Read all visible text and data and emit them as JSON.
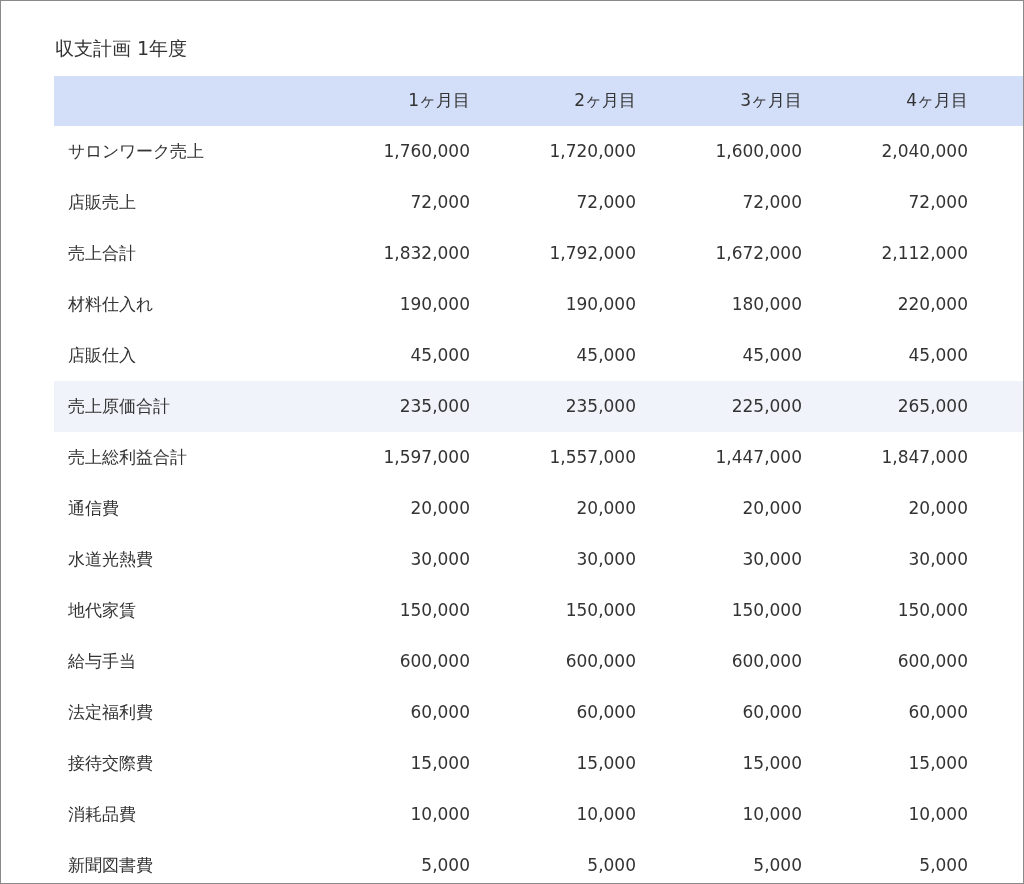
{
  "title": "収支計画 1年度",
  "table": {
    "columns": [
      "",
      "1ヶ月目",
      "2ヶ月目",
      "3ヶ月目",
      "4ヶ月目"
    ],
    "rows": [
      {
        "label": "サロンワーク売上",
        "values": [
          "1,760,000",
          "1,720,000",
          "1,600,000",
          "2,040,000"
        ],
        "selected": false
      },
      {
        "label": "店販売上",
        "values": [
          "72,000",
          "72,000",
          "72,000",
          "72,000"
        ],
        "selected": false
      },
      {
        "label": "売上合計",
        "values": [
          "1,832,000",
          "1,792,000",
          "1,672,000",
          "2,112,000"
        ],
        "selected": false
      },
      {
        "label": "材料仕入れ",
        "values": [
          "190,000",
          "190,000",
          "180,000",
          "220,000"
        ],
        "selected": false
      },
      {
        "label": "店販仕入",
        "values": [
          "45,000",
          "45,000",
          "45,000",
          "45,000"
        ],
        "selected": false
      },
      {
        "label": "売上原価合計",
        "values": [
          "235,000",
          "235,000",
          "225,000",
          "265,000"
        ],
        "selected": true
      },
      {
        "label": "売上総利益合計",
        "values": [
          "1,597,000",
          "1,557,000",
          "1,447,000",
          "1,847,000"
        ],
        "selected": false
      },
      {
        "label": "通信費",
        "values": [
          "20,000",
          "20,000",
          "20,000",
          "20,000"
        ],
        "selected": false
      },
      {
        "label": "水道光熱費",
        "values": [
          "30,000",
          "30,000",
          "30,000",
          "30,000"
        ],
        "selected": false
      },
      {
        "label": "地代家賃",
        "values": [
          "150,000",
          "150,000",
          "150,000",
          "150,000"
        ],
        "selected": false
      },
      {
        "label": "給与手当",
        "values": [
          "600,000",
          "600,000",
          "600,000",
          "600,000"
        ],
        "selected": false
      },
      {
        "label": "法定福利費",
        "values": [
          "60,000",
          "60,000",
          "60,000",
          "60,000"
        ],
        "selected": false
      },
      {
        "label": "接待交際費",
        "values": [
          "15,000",
          "15,000",
          "15,000",
          "15,000"
        ],
        "selected": false
      },
      {
        "label": "消耗品費",
        "values": [
          "10,000",
          "10,000",
          "10,000",
          "10,000"
        ],
        "selected": false
      },
      {
        "label": "新聞図書費",
        "values": [
          "5,000",
          "5,000",
          "5,000",
          "5,000"
        ],
        "selected": false
      }
    ]
  }
}
